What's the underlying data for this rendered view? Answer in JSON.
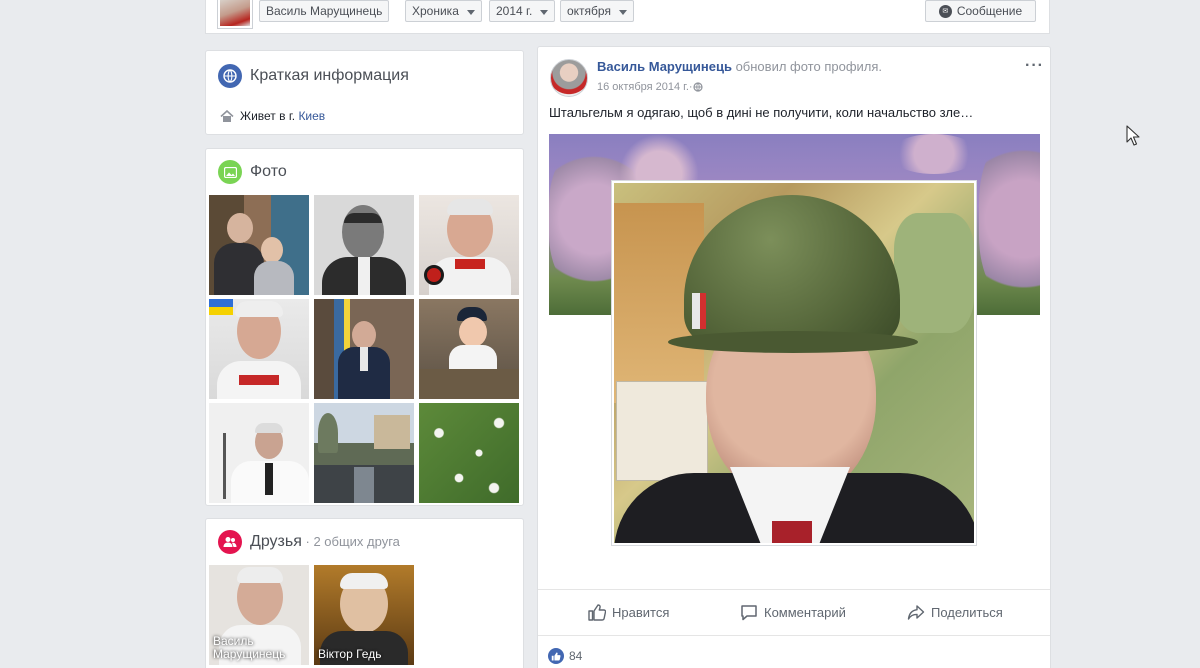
{
  "topbar": {
    "name_label": "Василь Марущинець",
    "timeline_label": "Хроника",
    "year_label": "2014 г.",
    "month_label": "октября",
    "message_label": "Сообщение",
    "message_icon": "messenger-icon"
  },
  "intro": {
    "title": "Краткая информация",
    "icon": "globe-icon",
    "lives_prefix": "Живет в г.",
    "lives_city": "Киев",
    "lives_icon": "home-icon"
  },
  "photos": {
    "title": "Фото",
    "icon": "photo-icon"
  },
  "friends": {
    "title": "Друзья",
    "separator": " · ",
    "mutual": "2 общих друга",
    "icon": "friends-icon",
    "items": [
      {
        "name": "Василь Марущинець"
      },
      {
        "name": "Віктор Гедь"
      }
    ]
  },
  "post": {
    "author": "Василь Марущинець",
    "action_text": "обновил фото профиля.",
    "date": "16 октября 2014 г.",
    "date_separator": " · ",
    "audience_icon": "globe-icon",
    "more_icon": "more-dots-icon",
    "text": "Штальгельм я одягаю, щоб в дині не получити, коли начальство зле…",
    "like_label": "Нравится",
    "comment_label": "Комментарий",
    "share_label": "Поделиться",
    "likes_count": "84"
  },
  "colors": {
    "facebook_blue": "#365899",
    "like_blue": "#4267b2",
    "background": "#e9ebee",
    "intro_icon": "#4267b2",
    "photo_icon": "#7ad454",
    "friends_icon": "#e4144f"
  }
}
